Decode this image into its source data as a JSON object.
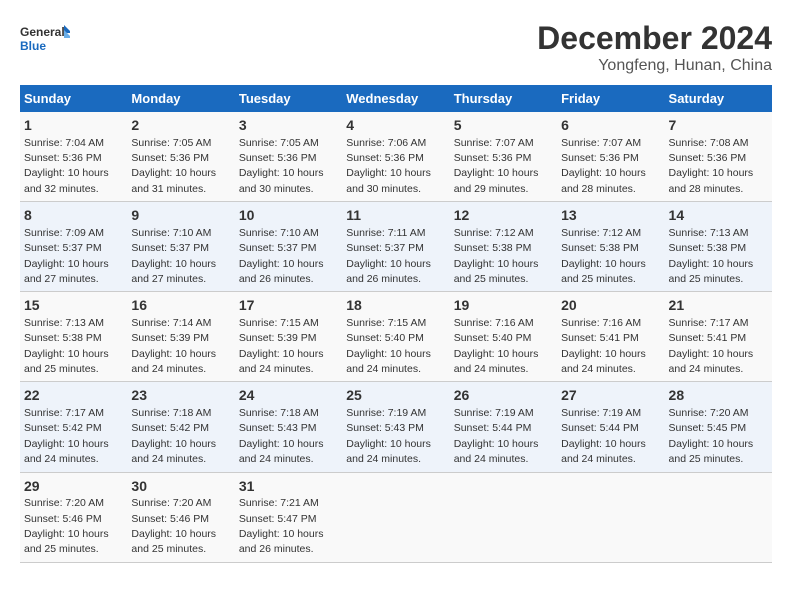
{
  "logo": {
    "text_general": "General",
    "text_blue": "Blue"
  },
  "title": "December 2024",
  "subtitle": "Yongfeng, Hunan, China",
  "days_of_week": [
    "Sunday",
    "Monday",
    "Tuesday",
    "Wednesday",
    "Thursday",
    "Friday",
    "Saturday"
  ],
  "weeks": [
    [
      {
        "day": "1",
        "sunrise": "Sunrise: 7:04 AM",
        "sunset": "Sunset: 5:36 PM",
        "daylight": "Daylight: 10 hours and 32 minutes."
      },
      {
        "day": "2",
        "sunrise": "Sunrise: 7:05 AM",
        "sunset": "Sunset: 5:36 PM",
        "daylight": "Daylight: 10 hours and 31 minutes."
      },
      {
        "day": "3",
        "sunrise": "Sunrise: 7:05 AM",
        "sunset": "Sunset: 5:36 PM",
        "daylight": "Daylight: 10 hours and 30 minutes."
      },
      {
        "day": "4",
        "sunrise": "Sunrise: 7:06 AM",
        "sunset": "Sunset: 5:36 PM",
        "daylight": "Daylight: 10 hours and 30 minutes."
      },
      {
        "day": "5",
        "sunrise": "Sunrise: 7:07 AM",
        "sunset": "Sunset: 5:36 PM",
        "daylight": "Daylight: 10 hours and 29 minutes."
      },
      {
        "day": "6",
        "sunrise": "Sunrise: 7:07 AM",
        "sunset": "Sunset: 5:36 PM",
        "daylight": "Daylight: 10 hours and 28 minutes."
      },
      {
        "day": "7",
        "sunrise": "Sunrise: 7:08 AM",
        "sunset": "Sunset: 5:36 PM",
        "daylight": "Daylight: 10 hours and 28 minutes."
      }
    ],
    [
      {
        "day": "8",
        "sunrise": "Sunrise: 7:09 AM",
        "sunset": "Sunset: 5:37 PM",
        "daylight": "Daylight: 10 hours and 27 minutes."
      },
      {
        "day": "9",
        "sunrise": "Sunrise: 7:10 AM",
        "sunset": "Sunset: 5:37 PM",
        "daylight": "Daylight: 10 hours and 27 minutes."
      },
      {
        "day": "10",
        "sunrise": "Sunrise: 7:10 AM",
        "sunset": "Sunset: 5:37 PM",
        "daylight": "Daylight: 10 hours and 26 minutes."
      },
      {
        "day": "11",
        "sunrise": "Sunrise: 7:11 AM",
        "sunset": "Sunset: 5:37 PM",
        "daylight": "Daylight: 10 hours and 26 minutes."
      },
      {
        "day": "12",
        "sunrise": "Sunrise: 7:12 AM",
        "sunset": "Sunset: 5:38 PM",
        "daylight": "Daylight: 10 hours and 25 minutes."
      },
      {
        "day": "13",
        "sunrise": "Sunrise: 7:12 AM",
        "sunset": "Sunset: 5:38 PM",
        "daylight": "Daylight: 10 hours and 25 minutes."
      },
      {
        "day": "14",
        "sunrise": "Sunrise: 7:13 AM",
        "sunset": "Sunset: 5:38 PM",
        "daylight": "Daylight: 10 hours and 25 minutes."
      }
    ],
    [
      {
        "day": "15",
        "sunrise": "Sunrise: 7:13 AM",
        "sunset": "Sunset: 5:38 PM",
        "daylight": "Daylight: 10 hours and 25 minutes."
      },
      {
        "day": "16",
        "sunrise": "Sunrise: 7:14 AM",
        "sunset": "Sunset: 5:39 PM",
        "daylight": "Daylight: 10 hours and 24 minutes."
      },
      {
        "day": "17",
        "sunrise": "Sunrise: 7:15 AM",
        "sunset": "Sunset: 5:39 PM",
        "daylight": "Daylight: 10 hours and 24 minutes."
      },
      {
        "day": "18",
        "sunrise": "Sunrise: 7:15 AM",
        "sunset": "Sunset: 5:40 PM",
        "daylight": "Daylight: 10 hours and 24 minutes."
      },
      {
        "day": "19",
        "sunrise": "Sunrise: 7:16 AM",
        "sunset": "Sunset: 5:40 PM",
        "daylight": "Daylight: 10 hours and 24 minutes."
      },
      {
        "day": "20",
        "sunrise": "Sunrise: 7:16 AM",
        "sunset": "Sunset: 5:41 PM",
        "daylight": "Daylight: 10 hours and 24 minutes."
      },
      {
        "day": "21",
        "sunrise": "Sunrise: 7:17 AM",
        "sunset": "Sunset: 5:41 PM",
        "daylight": "Daylight: 10 hours and 24 minutes."
      }
    ],
    [
      {
        "day": "22",
        "sunrise": "Sunrise: 7:17 AM",
        "sunset": "Sunset: 5:42 PM",
        "daylight": "Daylight: 10 hours and 24 minutes."
      },
      {
        "day": "23",
        "sunrise": "Sunrise: 7:18 AM",
        "sunset": "Sunset: 5:42 PM",
        "daylight": "Daylight: 10 hours and 24 minutes."
      },
      {
        "day": "24",
        "sunrise": "Sunrise: 7:18 AM",
        "sunset": "Sunset: 5:43 PM",
        "daylight": "Daylight: 10 hours and 24 minutes."
      },
      {
        "day": "25",
        "sunrise": "Sunrise: 7:19 AM",
        "sunset": "Sunset: 5:43 PM",
        "daylight": "Daylight: 10 hours and 24 minutes."
      },
      {
        "day": "26",
        "sunrise": "Sunrise: 7:19 AM",
        "sunset": "Sunset: 5:44 PM",
        "daylight": "Daylight: 10 hours and 24 minutes."
      },
      {
        "day": "27",
        "sunrise": "Sunrise: 7:19 AM",
        "sunset": "Sunset: 5:44 PM",
        "daylight": "Daylight: 10 hours and 24 minutes."
      },
      {
        "day": "28",
        "sunrise": "Sunrise: 7:20 AM",
        "sunset": "Sunset: 5:45 PM",
        "daylight": "Daylight: 10 hours and 25 minutes."
      }
    ],
    [
      {
        "day": "29",
        "sunrise": "Sunrise: 7:20 AM",
        "sunset": "Sunset: 5:46 PM",
        "daylight": "Daylight: 10 hours and 25 minutes."
      },
      {
        "day": "30",
        "sunrise": "Sunrise: 7:20 AM",
        "sunset": "Sunset: 5:46 PM",
        "daylight": "Daylight: 10 hours and 25 minutes."
      },
      {
        "day": "31",
        "sunrise": "Sunrise: 7:21 AM",
        "sunset": "Sunset: 5:47 PM",
        "daylight": "Daylight: 10 hours and 26 minutes."
      },
      {
        "day": "",
        "sunrise": "",
        "sunset": "",
        "daylight": ""
      },
      {
        "day": "",
        "sunrise": "",
        "sunset": "",
        "daylight": ""
      },
      {
        "day": "",
        "sunrise": "",
        "sunset": "",
        "daylight": ""
      },
      {
        "day": "",
        "sunrise": "",
        "sunset": "",
        "daylight": ""
      }
    ]
  ]
}
